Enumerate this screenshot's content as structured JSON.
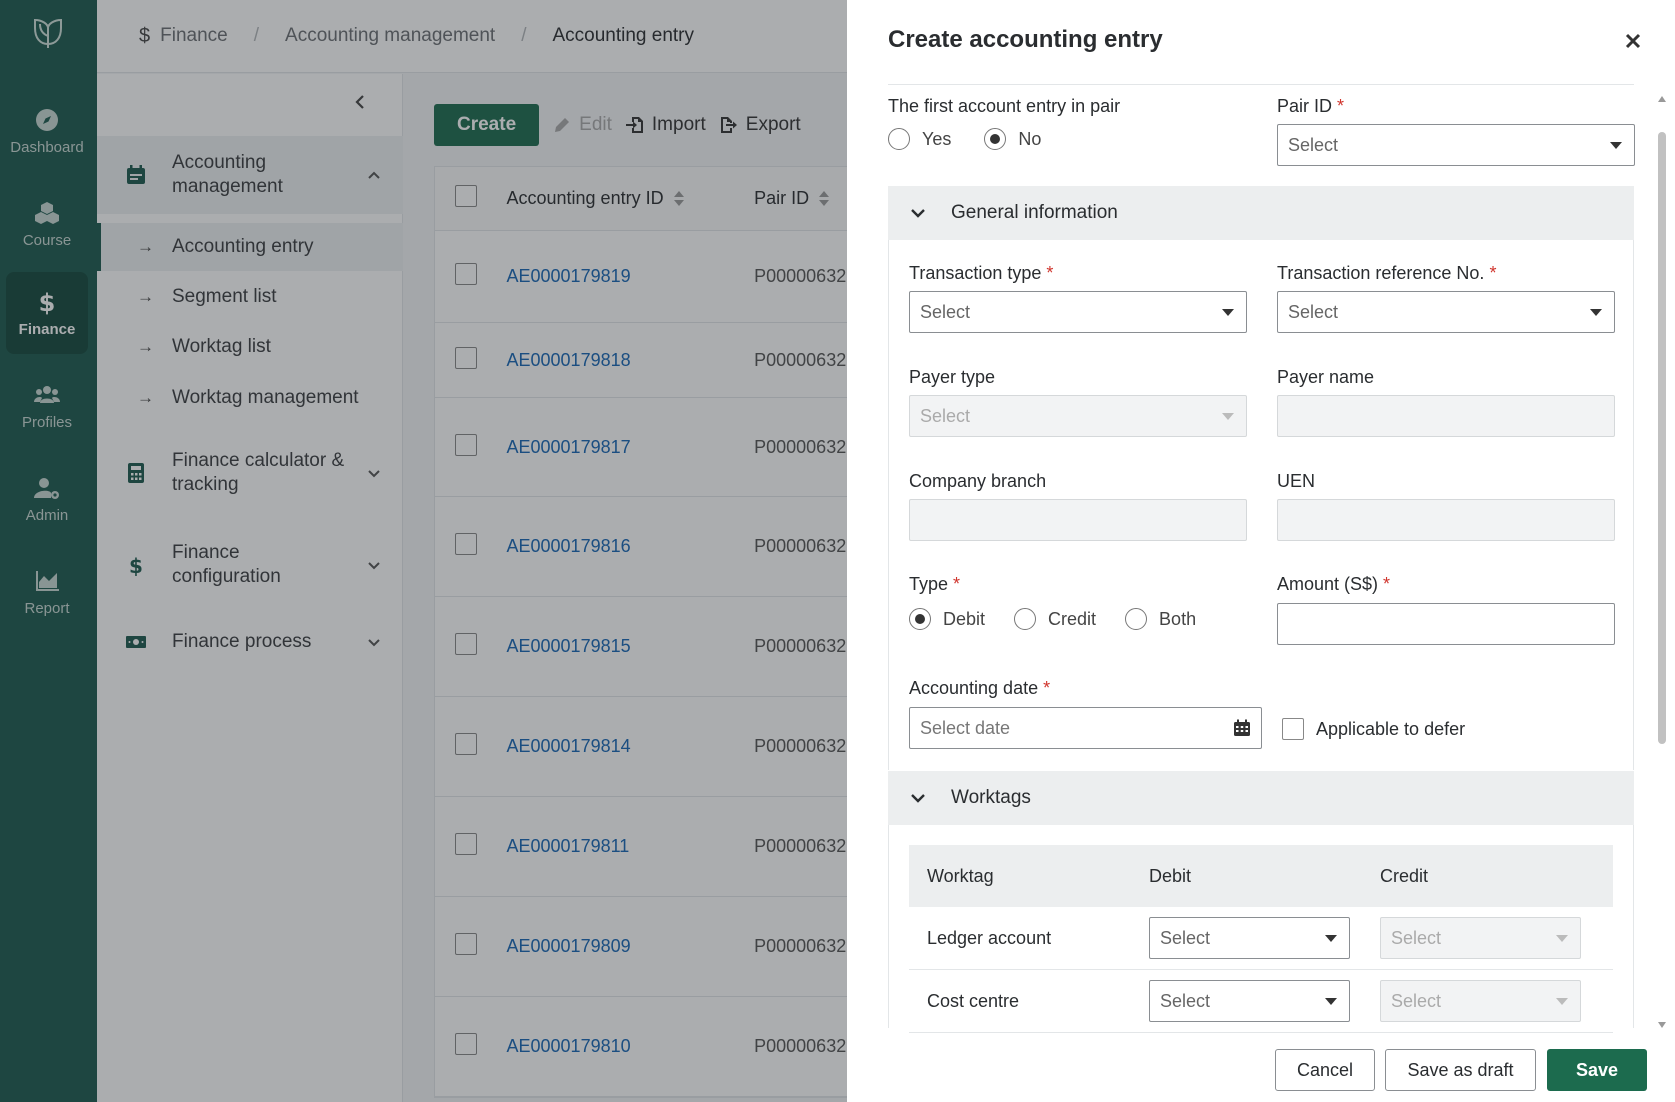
{
  "rail": {
    "items": [
      {
        "label": "Dashboard"
      },
      {
        "label": "Course"
      },
      {
        "label": "Finance"
      },
      {
        "label": "Profiles"
      },
      {
        "label": "Admin"
      },
      {
        "label": "Report"
      }
    ]
  },
  "breadcrumb": {
    "items": [
      "Finance",
      "Accounting management",
      "Accounting entry"
    ]
  },
  "sidenav": {
    "groups": [
      {
        "label": "Accounting management"
      },
      {
        "label": "Finance calculator & tracking"
      },
      {
        "label": "Finance configuration"
      },
      {
        "label": "Finance process"
      }
    ],
    "subitems": [
      {
        "label": "Accounting entry"
      },
      {
        "label": "Segment list"
      },
      {
        "label": "Worktag list"
      },
      {
        "label": "Worktag management"
      }
    ]
  },
  "toolbar": {
    "create_label": "Create",
    "edit_label": "Edit",
    "import_label": "Import",
    "export_label": "Export"
  },
  "table": {
    "columns": [
      "Accounting entry ID",
      "Pair ID"
    ],
    "rows": [
      {
        "id": "AE0000179819",
        "pair": "P00000632"
      },
      {
        "id": "AE0000179818",
        "pair": "P00000632"
      },
      {
        "id": "AE0000179817",
        "pair": "P00000632"
      },
      {
        "id": "AE0000179816",
        "pair": "P00000632"
      },
      {
        "id": "AE0000179815",
        "pair": "P00000632"
      },
      {
        "id": "AE0000179814",
        "pair": "P00000632"
      },
      {
        "id": "AE0000179811",
        "pair": "P00000632"
      },
      {
        "id": "AE0000179809",
        "pair": "P00000632"
      },
      {
        "id": "AE0000179810",
        "pair": "P00000632"
      }
    ]
  },
  "drawer": {
    "title": "Create accounting entry",
    "first_entry": {
      "label": "The first account entry in pair",
      "options": [
        "Yes",
        "No"
      ],
      "selected": "No"
    },
    "pair_id": {
      "label": "Pair ID",
      "placeholder": "Select"
    },
    "general_section": {
      "title": "General information",
      "transaction_type": {
        "label": "Transaction type",
        "placeholder": "Select"
      },
      "transaction_ref": {
        "label": "Transaction reference No.",
        "placeholder": "Select"
      },
      "payer_type": {
        "label": "Payer type",
        "placeholder": "Select"
      },
      "payer_name": {
        "label": "Payer name"
      },
      "company_branch": {
        "label": "Company branch"
      },
      "uen": {
        "label": "UEN"
      },
      "type": {
        "label": "Type",
        "options": [
          "Debit",
          "Credit",
          "Both"
        ],
        "selected": "Debit"
      },
      "amount": {
        "label": "Amount (S$)"
      },
      "accounting_date": {
        "label": "Accounting date",
        "placeholder": "Select date"
      },
      "defer": {
        "label": "Applicable to defer"
      }
    },
    "worktags_section": {
      "title": "Worktags",
      "columns": [
        "Worktag",
        "Debit",
        "Credit"
      ],
      "rows": [
        {
          "name": "Ledger account",
          "debit": "Select",
          "credit": "Select"
        },
        {
          "name": "Cost centre",
          "debit": "Select",
          "credit": "Select"
        }
      ]
    },
    "footer": {
      "cancel_label": "Cancel",
      "draft_label": "Save as draft",
      "save_label": "Save"
    }
  }
}
